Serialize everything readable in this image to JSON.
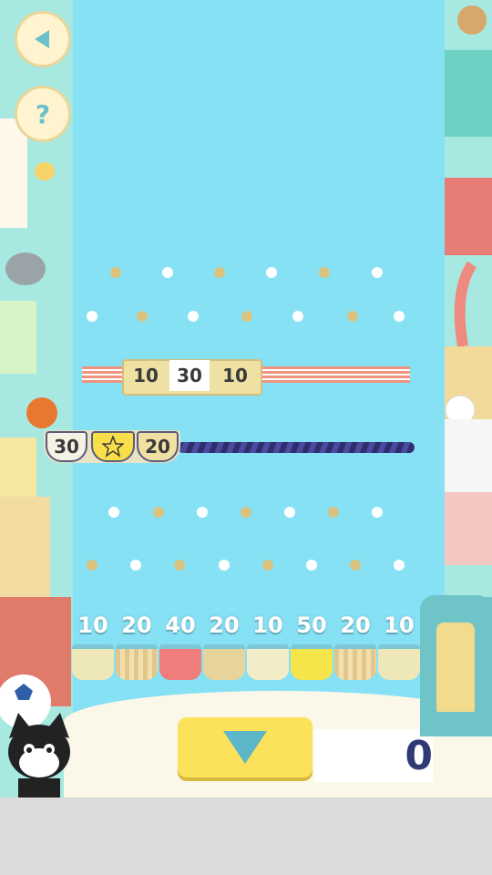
{
  "controls": {
    "back_icon": "back-arrow",
    "help_label": "?",
    "drop_icon": "down-triangle"
  },
  "upper_bar": {
    "labels": [
      "10",
      "30",
      "10"
    ]
  },
  "lower_bar": {
    "labels": [
      "30",
      "",
      "20"
    ]
  },
  "cups": [
    {
      "value": "10"
    },
    {
      "value": "20"
    },
    {
      "value": "40"
    },
    {
      "value": "20"
    },
    {
      "value": "10"
    },
    {
      "value": "50"
    },
    {
      "value": "20"
    },
    {
      "value": "10"
    }
  ],
  "score": {
    "value": "0"
  },
  "colors": {
    "sky": "#86e1f5",
    "accent_yellow": "#fbe25a",
    "score_text": "#2f3a75",
    "peg_gold": "#d9c37f",
    "peg_white": "#ffffff"
  }
}
